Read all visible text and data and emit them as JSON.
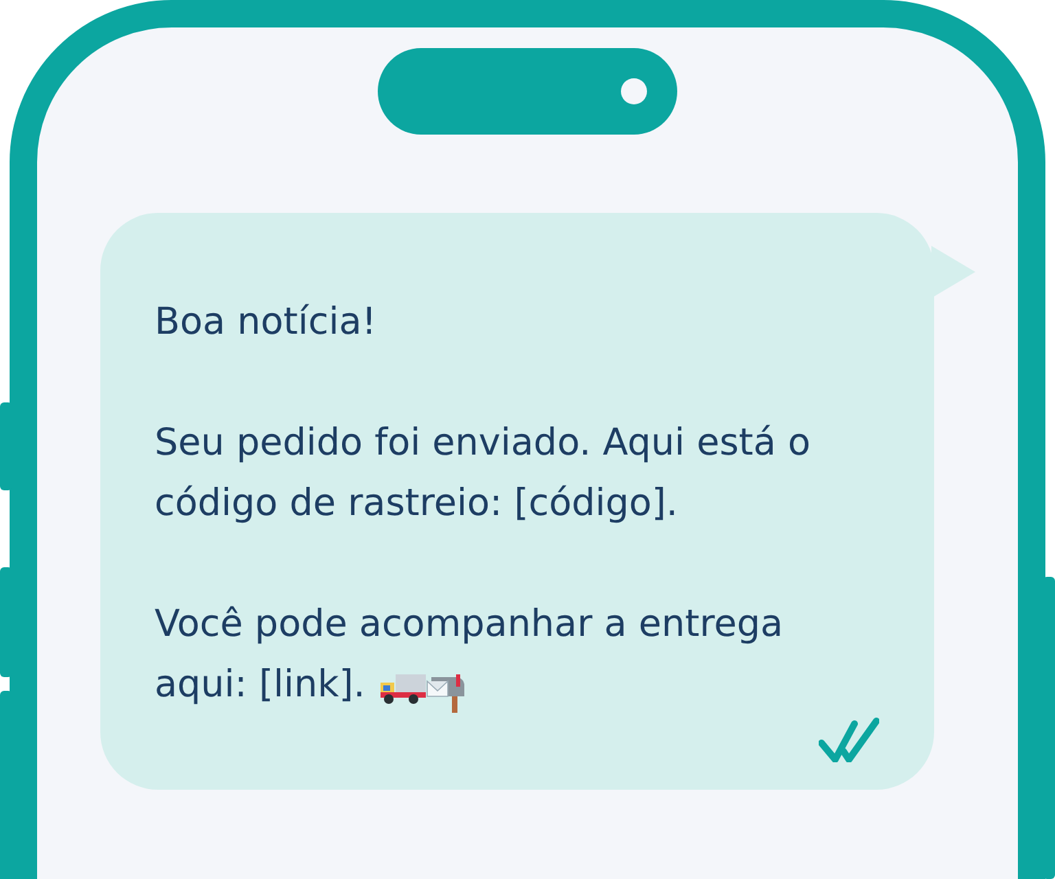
{
  "message": {
    "paragraphs": [
      "Boa notícia!",
      "Seu pedido foi enviado. Aqui está o código de rastreio: [código].",
      "Você pode acompanhar a entrega aqui: [link]."
    ],
    "trailing_emoji": true,
    "read": true
  }
}
